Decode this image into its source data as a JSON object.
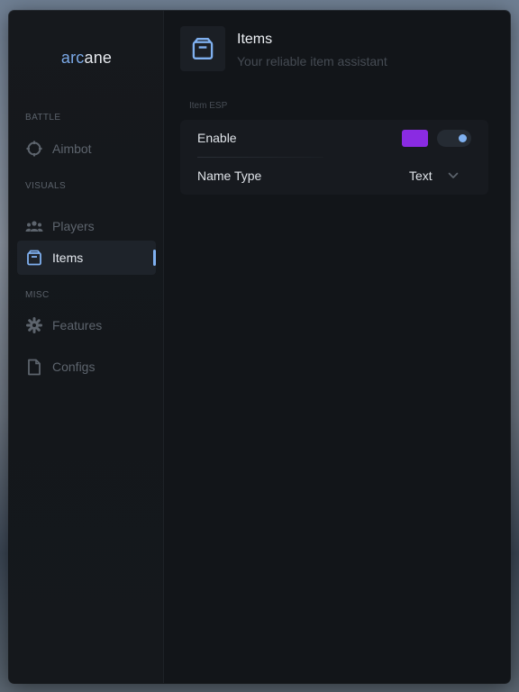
{
  "brand": {
    "part1": "arc",
    "part2": "ane"
  },
  "sidebar": {
    "sections": [
      {
        "label": "BATTLE",
        "items": [
          {
            "label": "Aimbot",
            "icon": "crosshair-icon",
            "active": false
          }
        ]
      },
      {
        "label": "VISUALS",
        "items": [
          {
            "label": "Players",
            "icon": "users-icon",
            "active": false
          },
          {
            "label": "Items",
            "icon": "box-icon",
            "active": true
          }
        ]
      },
      {
        "label": "MISC",
        "items": [
          {
            "label": "Features",
            "icon": "gear-icon",
            "active": false
          },
          {
            "label": "Configs",
            "icon": "file-icon",
            "active": false
          }
        ]
      }
    ]
  },
  "header": {
    "title": "Items",
    "subtitle": "Your reliable item assistant",
    "icon": "box-icon"
  },
  "item_esp": {
    "group_label": "Item ESP",
    "enable": {
      "label": "Enable",
      "color": "#8a2be2",
      "enabled": true
    },
    "name_type": {
      "label": "Name Type",
      "value": "Text"
    }
  },
  "colors": {
    "accent": "#7fb0f0",
    "background": "#121519",
    "sidebar": "#16191d"
  }
}
